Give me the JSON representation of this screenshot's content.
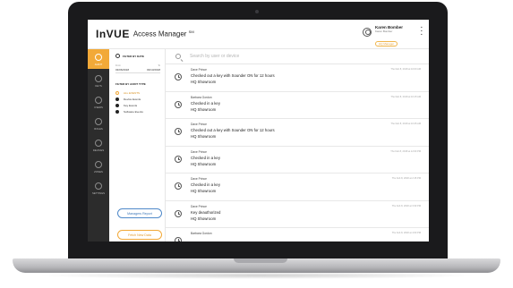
{
  "header": {
    "logo": "InVUE",
    "title": "Access Manager",
    "title_mark": "SM",
    "user_name": "Karen Bomber",
    "user_sub": "Karen Bomber",
    "role": "HQ Manager"
  },
  "nav": {
    "items": [
      {
        "label": "AUDIT",
        "icon": "audit-icon"
      },
      {
        "label": "KEYS",
        "icon": "key-icon"
      },
      {
        "label": "USERS",
        "icon": "users-icon"
      },
      {
        "label": "ROLES",
        "icon": "roles-icon"
      },
      {
        "label": "DEVICES",
        "icon": "devices-icon"
      },
      {
        "label": "ZONES",
        "icon": "zones-icon"
      },
      {
        "label": "SETTINGS",
        "icon": "gear-icon"
      }
    ],
    "active": "AUDIT"
  },
  "filter": {
    "title": "FILTER BY DATE",
    "from_label": "From",
    "to_label": "To",
    "from_value": "03/06/2018",
    "to_value": "03/13/2018",
    "type_title": "FILTER BY AUDIT TYPE",
    "types": [
      "ALL EVENTS",
      "Device Events",
      "Key Events",
      "Software Events"
    ],
    "selected_type": "ALL EVENTS",
    "manager_report_label": "Managers Report",
    "fetch_label": "Fetch New Data"
  },
  "search": {
    "placeholder": "Search by user or device"
  },
  "events": [
    {
      "user": "Dave Prince",
      "action": "Checked out a key with Sounder ON for 12 hours",
      "location": "HQ Showroom",
      "time": "Thu Feb 8, 2018 at 10:00 AM"
    },
    {
      "user": "Barbara Gordon",
      "action": "Checked in a key",
      "location": "HQ Showroom",
      "time": "Thu Feb 8, 2018 at 10:15 AM"
    },
    {
      "user": "Dave Prince",
      "action": "Checked out a key with Sounder ON for 12 hours",
      "location": "HQ Showroom",
      "time": "Thu Feb 8, 2018 at 10:45 AM"
    },
    {
      "user": "Dave Prince",
      "action": "Checked in a key",
      "location": "HQ Showroom",
      "time": "Thu Feb 8, 2018 at 12:00 PM"
    },
    {
      "user": "Dave Prince",
      "action": "Checked in a key",
      "location": "HQ Showroom",
      "time": "Thu Feb 8, 2018 at 2:15 PM"
    },
    {
      "user": "Dave Prince",
      "action": "Key deauthorized",
      "location": "HQ Showroom",
      "time": "Thu Feb 8, 2018 at 3:30 PM"
    },
    {
      "user": "Barbara Gordon",
      "action": "",
      "location": "",
      "time": "Thu Feb 8, 2018 at 4:00 PM"
    }
  ],
  "colors": {
    "accent": "#f2a938",
    "nav_bg": "#2c2c2c",
    "link_blue": "#3d77b9"
  }
}
